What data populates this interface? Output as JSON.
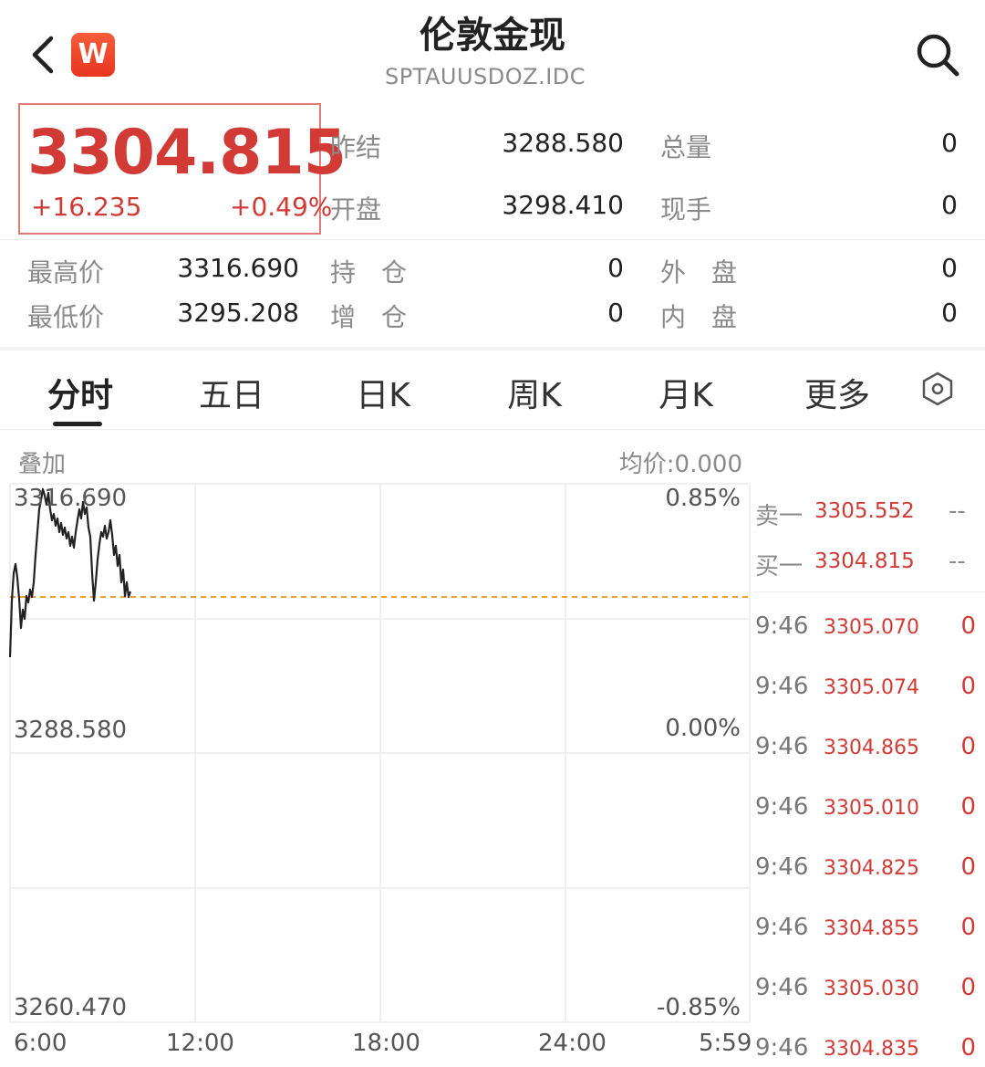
{
  "header": {
    "title": "伦敦金现",
    "subtitle": "SPTAUUSDOZ.IDC",
    "logo_letter": "W"
  },
  "quote": {
    "price": "3304.815",
    "change": "+16.235",
    "change_pct": "+0.49%"
  },
  "stats": {
    "prev_settle_label": "昨结",
    "prev_settle": "3288.580",
    "total_volume_label": "总量",
    "total_volume": "0",
    "open_label": "开盘",
    "open": "3298.410",
    "current_hand_label": "现手",
    "current_hand": "0",
    "high_label": "最高价",
    "high": "3316.690",
    "position_label": "持　仓",
    "position": "0",
    "outer_label": "外　盘",
    "outer": "0",
    "low_label": "最低价",
    "low": "3295.208",
    "increase_label": "增　仓",
    "increase": "0",
    "inner_label": "内　盘",
    "inner": "0"
  },
  "tabs": [
    {
      "label": "分时"
    },
    {
      "label": "五日"
    },
    {
      "label": "日K"
    },
    {
      "label": "周K"
    },
    {
      "label": "月K"
    },
    {
      "label": "更多"
    }
  ],
  "chart": {
    "overlay_label": "叠加",
    "avg_price_label": "均价:0.000",
    "top_price": "3316.690",
    "mid_price": "3288.580",
    "bottom_price": "3260.470",
    "top_pct": "0.85%",
    "mid_pct": "0.00%",
    "bottom_pct": "-0.85%",
    "time_labels": [
      "6:00",
      "12:00",
      "18:00",
      "24:00",
      "5:59"
    ]
  },
  "orderbook": {
    "sell1_label": "卖一",
    "sell1_price": "3305.552",
    "sell1_vol": "--",
    "buy1_label": "买一",
    "buy1_price": "3304.815",
    "buy1_vol": "--"
  },
  "ticks": [
    {
      "time": "9:46",
      "price": "3305.070",
      "vol": "0"
    },
    {
      "time": "9:46",
      "price": "3305.074",
      "vol": "0"
    },
    {
      "time": "9:46",
      "price": "3304.865",
      "vol": "0"
    },
    {
      "time": "9:46",
      "price": "3305.010",
      "vol": "0"
    },
    {
      "time": "9:46",
      "price": "3304.825",
      "vol": "0"
    },
    {
      "time": "9:46",
      "price": "3304.855",
      "vol": "0"
    },
    {
      "time": "9:46",
      "price": "3305.030",
      "vol": "0"
    },
    {
      "time": "9:46",
      "price": "3304.835",
      "vol": "0"
    }
  ],
  "colors": {
    "up": "#d23b35",
    "down": "#2e8b3c",
    "prev_close_line": "#f0a030",
    "price_line": "#222222"
  }
}
